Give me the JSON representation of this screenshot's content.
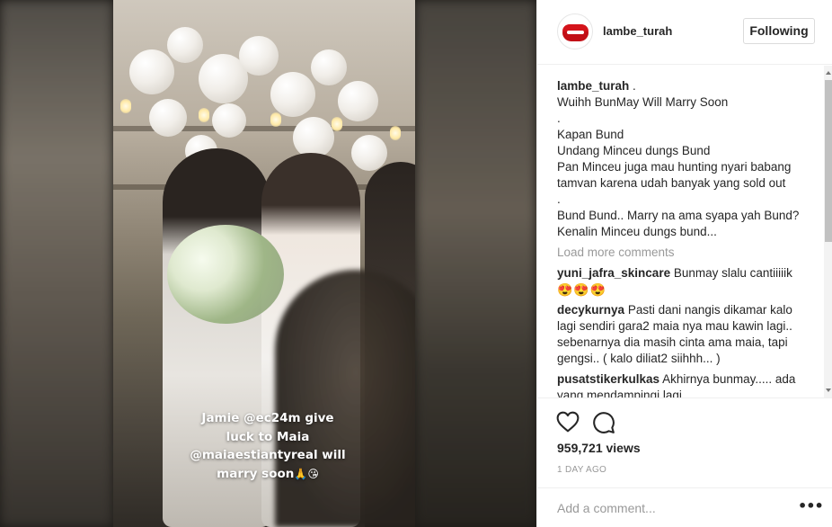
{
  "post": {
    "username": "lambe_turah",
    "follow_label": "Following",
    "avatar_brand": "LAMBE TURAH",
    "caption_user": "lambe_turah",
    "caption_lines": [
      ".",
      "Wuihh BunMay Will Marry Soon",
      ".",
      "Kapan Bund",
      "Undang Minceu dungs Bund",
      "Pan Minceu juga mau hunting nyari babang tamvan karena udah banyak yang sold out",
      ".",
      "Bund Bund.. Marry na ama syapa yah Bund?",
      "Kenalin Minceu dungs bund..."
    ],
    "load_more": "Load more comments",
    "comments": [
      {
        "user": "yuni_jafra_skincare",
        "text": "Bunmay slalu cantiiiiik",
        "emojis": "😍😍😍"
      },
      {
        "user": "decykurnya",
        "text": "Pasti dani nangis dikamar kalo lagi sendiri gara2 maia nya mau kawin lagi.. sebenarnya dia masih cinta ama maia, tapi gengsi.. ( kalo diliat2 siihhh... )"
      },
      {
        "user": "pusatstikerkulkas",
        "text": "Akhirnya bunmay..... ada yang mendampingi lagi"
      }
    ],
    "views": "959,721 views",
    "posted": "1 DAY AGO",
    "add_comment_placeholder": "Add a comment...",
    "more_label": "•••"
  },
  "media": {
    "story_caption": {
      "line1": "Jamie @ec24m give",
      "line2": "luck to Maia",
      "line3": "@maiaestiantyreal will",
      "line4": "marry soon",
      "emojis": "🙏😘"
    }
  },
  "icons": {
    "heart": "heart-icon",
    "comment": "comment-icon",
    "more": "more-options-icon"
  },
  "colors": {
    "brand_red": "#d4141b",
    "muted_text": "#999999",
    "divider": "#efefef"
  }
}
